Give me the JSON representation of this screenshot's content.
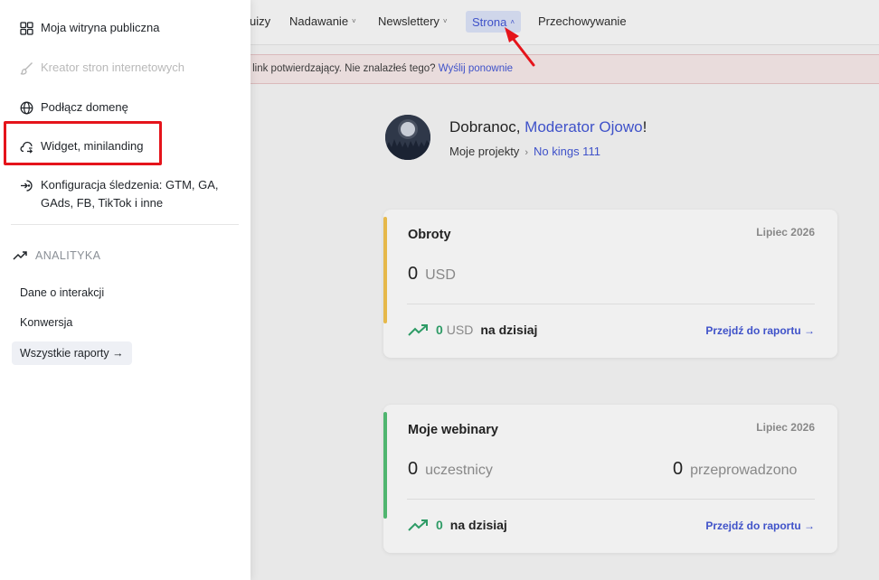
{
  "topnav": {
    "items": [
      {
        "label": "uizy"
      },
      {
        "label": "Nadawanie",
        "chevron": "˅"
      },
      {
        "label": "Newslettery",
        "chevron": "˅"
      },
      {
        "label": "Strona",
        "chevron": "˄",
        "active": true
      },
      {
        "label": "Przechowywanie"
      }
    ]
  },
  "alert": {
    "text": "niał link potwierdzający. Nie znalazłeś tego?",
    "link": "Wyślij ponownie"
  },
  "greeting": {
    "prefix": "Dobranoc, ",
    "name": "Moderator Ojowo",
    "suffix": "!",
    "crumb_root": "Moje projekty",
    "crumb_sep": "›",
    "crumb_project": "No kings 111"
  },
  "card_turnover": {
    "title": "Obroty",
    "period": "Lipiec 2026",
    "value": "0",
    "unit": "USD",
    "today_value": "0",
    "today_unit": "USD",
    "today_label": "na dzisiaj",
    "report_link": "Przejdź do raportu →",
    "accent": "#e6b84a"
  },
  "card_webinars": {
    "title": "Moje webinary",
    "period": "Lipiec 2026",
    "value_left": "0",
    "unit_left": "uczestnicy",
    "value_right": "0",
    "unit_right": "przeprowadzono",
    "today_value": "0",
    "today_label": "na dzisiaj",
    "report_link": "Przejdź do raportu →",
    "accent": "#4fb56f"
  },
  "menu": {
    "items": [
      {
        "label": "Moja witryna publiczna",
        "icon": "grid-icon"
      },
      {
        "label": "Kreator stron internetowych",
        "icon": "brush-icon",
        "disabled": true
      },
      {
        "label": "Podłącz domenę",
        "icon": "globe-icon"
      },
      {
        "label": "Widget, minilanding",
        "icon": "cloud-sync-icon",
        "highlighted": true
      },
      {
        "label": "Konfiguracja śledzenia: GTM, GA, GAds, FB, TikTok i inne",
        "icon": "tracking-icon"
      }
    ],
    "analytics": {
      "title": "ANALITYKA",
      "icon": "trend-up-icon",
      "links": [
        "Dane o interakcji",
        "Konwersja"
      ],
      "all_reports": "Wszystkie raporty →"
    }
  },
  "colors": {
    "link": "#3f52c9",
    "highlight_box": "#e5141b",
    "annotation_arrow": "#e5141b",
    "trend_green": "#2e9b66"
  }
}
